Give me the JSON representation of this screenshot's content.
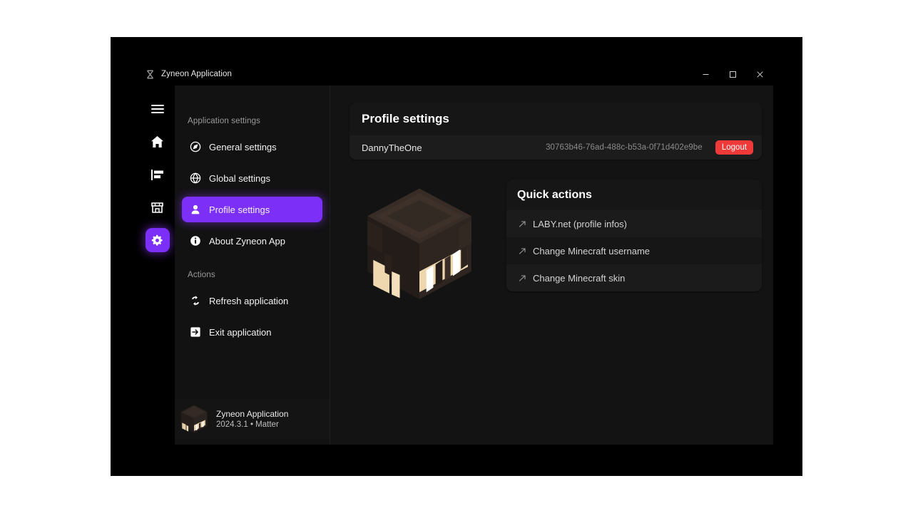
{
  "window": {
    "title": "Zyneon Application",
    "logo_icon": "zyneon-logo-icon",
    "controls": {
      "minimize": "minimize-icon",
      "maximize": "maximize-icon",
      "close": "close-icon"
    }
  },
  "rail": {
    "items": [
      {
        "icon": "hamburger-menu-icon",
        "name": "menu",
        "active": false
      },
      {
        "icon": "home-icon",
        "name": "home",
        "active": false
      },
      {
        "icon": "news-list-icon",
        "name": "news",
        "active": false
      },
      {
        "icon": "store-icon",
        "name": "store",
        "active": false
      },
      {
        "icon": "gear-icon",
        "name": "settings",
        "active": true
      }
    ]
  },
  "nav": {
    "section_application": "Application settings",
    "section_actions": "Actions",
    "items": [
      {
        "label": "General settings",
        "icon": "compass-icon",
        "active": false
      },
      {
        "label": "Global settings",
        "icon": "globe-icon",
        "active": false
      },
      {
        "label": "Profile settings",
        "icon": "person-icon",
        "active": true
      },
      {
        "label": "About Zyneon App",
        "icon": "info-circle-icon",
        "active": false
      }
    ],
    "actions": [
      {
        "label": "Refresh application",
        "icon": "refresh-icon"
      },
      {
        "label": "Exit application",
        "icon": "exit-icon"
      }
    ],
    "footer": {
      "app_name": "Zyneon Application",
      "version": "2024.3.1 • Matter",
      "avatar_icon": "minecraft-head-icon"
    }
  },
  "profile": {
    "card_title": "Profile settings",
    "username": "DannyTheOne",
    "uuid": "30763b46-76ad-488c-b53a-0f71d402e9be",
    "logout_label": "Logout"
  },
  "quick_actions": {
    "title": "Quick actions",
    "items": [
      {
        "label": "LABY.net (profile infos)",
        "icon": "arrow-up-right-icon"
      },
      {
        "label": "Change Minecraft username",
        "icon": "arrow-up-right-icon"
      },
      {
        "label": "Change Minecraft skin",
        "icon": "arrow-up-right-icon"
      }
    ]
  },
  "skin": {
    "preview_name": "minecraft-skin-head-preview"
  },
  "colors": {
    "accent": "#7b2ff7",
    "danger": "#f03a3a",
    "window_bg": "#0a0a0a",
    "panel_bg": "#121212",
    "content_bg": "#131313",
    "card_bg": "#161616"
  }
}
